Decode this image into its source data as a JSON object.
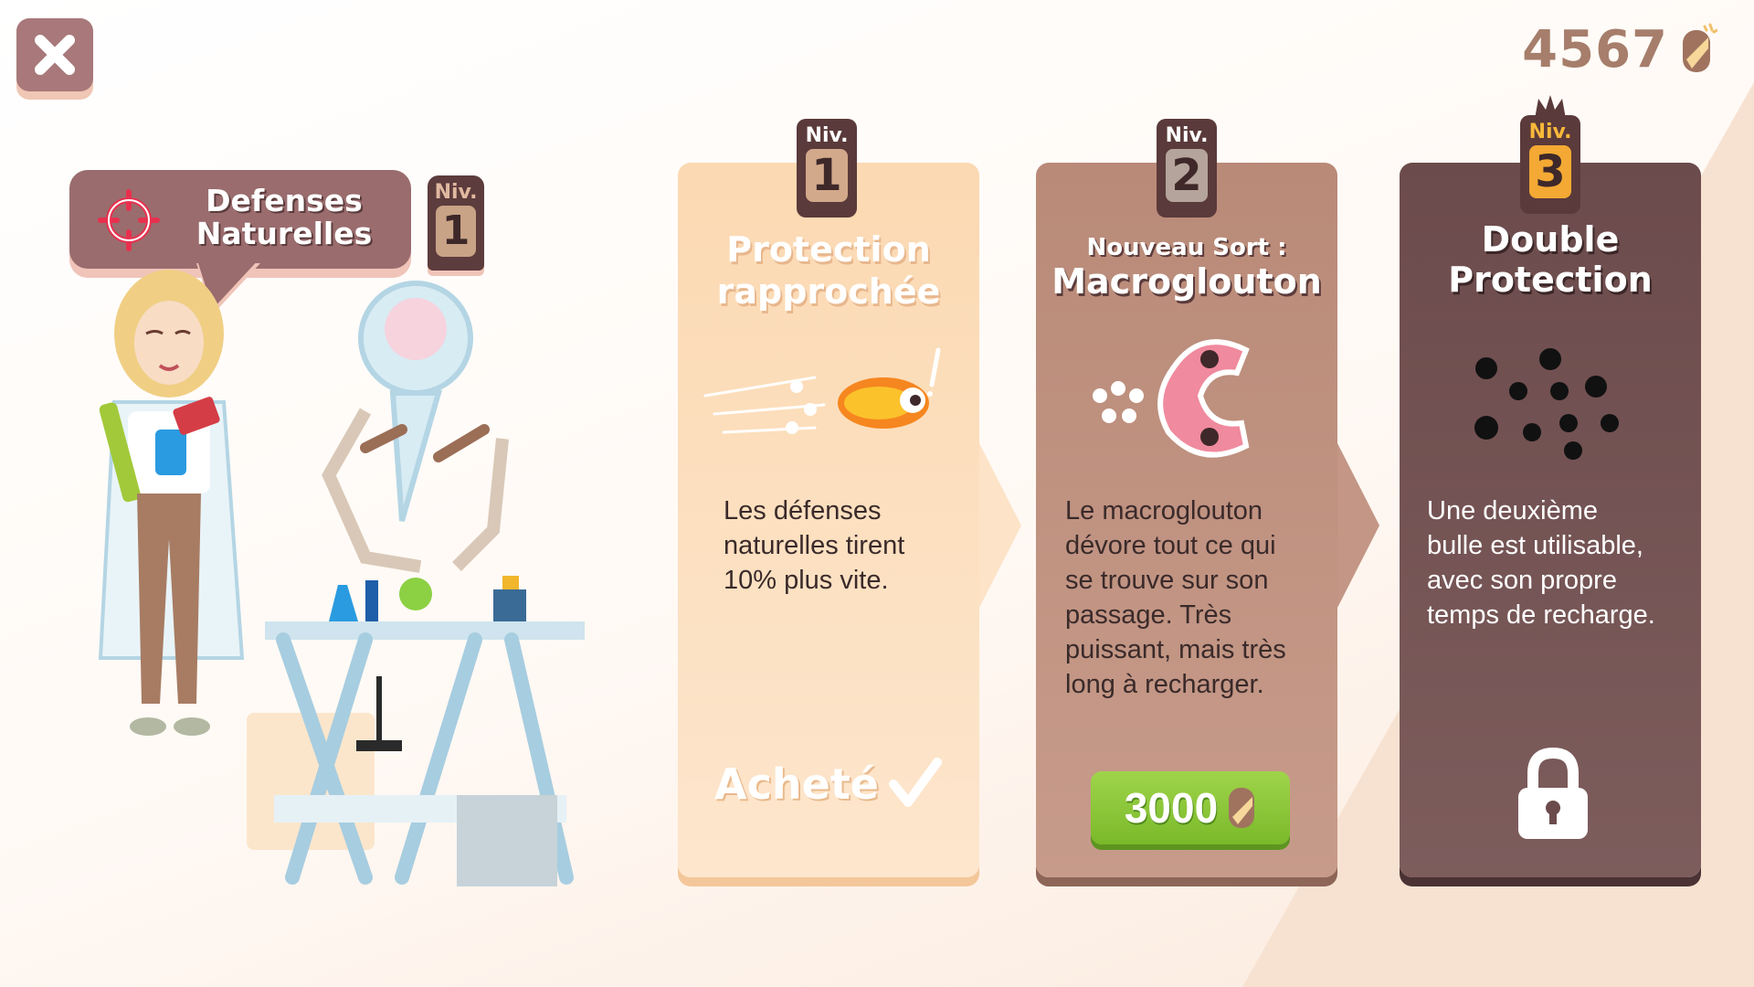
{
  "header": {
    "coins": "4567"
  },
  "skill": {
    "name_line1": "Defenses",
    "name_line2": "Naturelles",
    "level_label": "Niv.",
    "level": "1"
  },
  "cards": [
    {
      "level_label": "Niv.",
      "level": "1",
      "title_line1": "Protection",
      "title_line2": "rapprochée",
      "description_lines": [
        "Les défenses",
        "naturelles tirent",
        "10% plus vite."
      ],
      "status": "Acheté"
    },
    {
      "level_label": "Niv.",
      "level": "2",
      "subtitle": "Nouveau Sort :",
      "title": "Macroglouton",
      "description_lines": [
        "Le macroglouton",
        "dévore tout ce qui",
        "se trouve sur son",
        "passage. Très",
        "puissant, mais très",
        "long à recharger."
      ],
      "price": "3000"
    },
    {
      "level_label": "Niv.",
      "level": "3",
      "title_line1": "Double",
      "title_line2": "Protection",
      "description_lines": [
        "Une deuxième",
        "bulle est utilisable,",
        "avec son propre",
        "temps de recharge."
      ],
      "locked": true
    }
  ],
  "colors": {
    "card1": "#fbd9b2",
    "card2": "#b98a78",
    "card3": "#6c4b4c",
    "price_button": "#8cc63f",
    "coins_text": "#a67e6b"
  },
  "icons": {
    "close": "close-icon",
    "coin": "coin-icon",
    "skill": "target-icon",
    "check": "checkmark-icon",
    "lock": "lock-icon"
  }
}
